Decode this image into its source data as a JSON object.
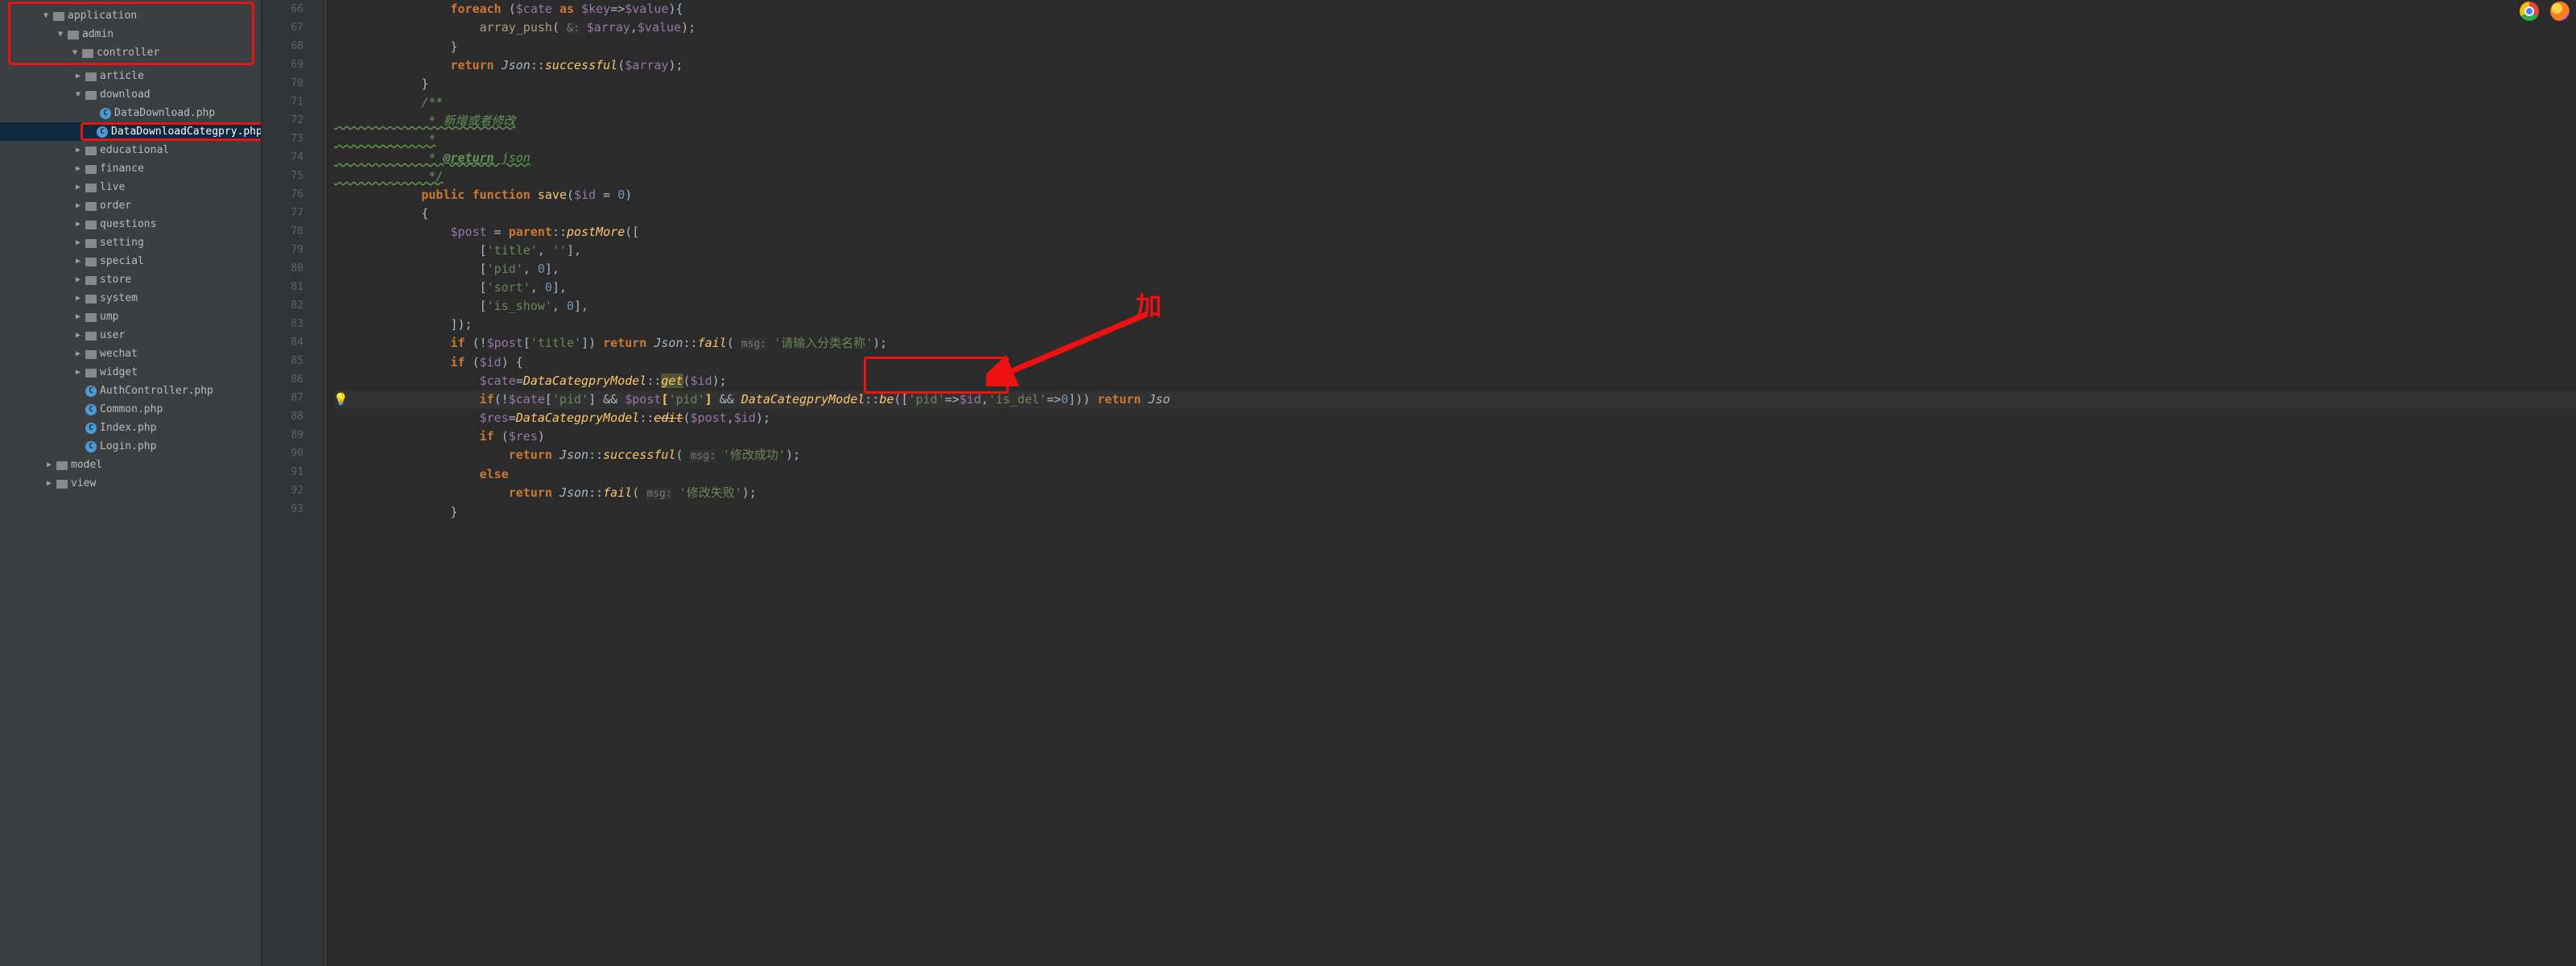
{
  "sidebar": {
    "items": [
      {
        "depth": 2,
        "arrow": "down",
        "kind": "folder",
        "label": "application"
      },
      {
        "depth": 3,
        "arrow": "down",
        "kind": "folder",
        "label": "admin"
      },
      {
        "depth": 4,
        "arrow": "down",
        "kind": "folder",
        "label": "controller"
      },
      {
        "depth": 5,
        "arrow": "right",
        "kind": "folder",
        "label": "article"
      },
      {
        "depth": 5,
        "arrow": "down",
        "kind": "folder",
        "label": "download"
      },
      {
        "depth": 6,
        "arrow": "",
        "kind": "file",
        "label": "DataDownload.php"
      },
      {
        "depth": 6,
        "arrow": "",
        "kind": "file",
        "label": "DataDownloadCategpry.php",
        "selected": true
      },
      {
        "depth": 5,
        "arrow": "right",
        "kind": "folder",
        "label": "educational"
      },
      {
        "depth": 5,
        "arrow": "right",
        "kind": "folder",
        "label": "finance"
      },
      {
        "depth": 5,
        "arrow": "right",
        "kind": "folder",
        "label": "live"
      },
      {
        "depth": 5,
        "arrow": "right",
        "kind": "folder",
        "label": "order"
      },
      {
        "depth": 5,
        "arrow": "right",
        "kind": "folder",
        "label": "questions"
      },
      {
        "depth": 5,
        "arrow": "right",
        "kind": "folder",
        "label": "setting"
      },
      {
        "depth": 5,
        "arrow": "right",
        "kind": "folder",
        "label": "special"
      },
      {
        "depth": 5,
        "arrow": "right",
        "kind": "folder",
        "label": "store"
      },
      {
        "depth": 5,
        "arrow": "right",
        "kind": "folder",
        "label": "system"
      },
      {
        "depth": 5,
        "arrow": "right",
        "kind": "folder",
        "label": "ump"
      },
      {
        "depth": 5,
        "arrow": "right",
        "kind": "folder",
        "label": "user"
      },
      {
        "depth": 5,
        "arrow": "right",
        "kind": "folder",
        "label": "wechat"
      },
      {
        "depth": 5,
        "arrow": "right",
        "kind": "folder",
        "label": "widget"
      },
      {
        "depth": 5,
        "arrow": "",
        "kind": "file",
        "label": "AuthController.php"
      },
      {
        "depth": 5,
        "arrow": "",
        "kind": "file",
        "label": "Common.php"
      },
      {
        "depth": 5,
        "arrow": "",
        "kind": "file",
        "label": "Index.php"
      },
      {
        "depth": 5,
        "arrow": "",
        "kind": "file",
        "label": "Login.php"
      },
      {
        "depth": 3,
        "arrow": "right",
        "kind": "folder",
        "label": "model"
      },
      {
        "depth": 3,
        "arrow": "right",
        "kind": "folder",
        "label": "view"
      }
    ]
  },
  "code": {
    "first_line": 66,
    "lines": [
      {
        "html": "                <span class='kw'>foreach</span> (<span class='var'>$cate</span> <span class='kw'>as</span> <span class='var'>$key</span>=&gt;<span class='var'>$value</span>){"
      },
      {
        "html": "                    <span class='call'>array_push</span>( <span class='hint'>&amp;:</span> <span class='var'>$array</span>,<span class='var'>$value</span>);"
      },
      {
        "html": "                }"
      },
      {
        "html": "                <span class='kw'>return</span> <span class='sta'>Json</span>::<span class='fn'>successful</span>(<span class='var'>$array</span>);"
      },
      {
        "html": "            }"
      },
      {
        "html": "            <span class='cmt'>/**</span>"
      },
      {
        "html": "<span class='wavy'>             <span class='cmt'>* 新增或者修改</span></span>"
      },
      {
        "html": "<span class='wavy'>             <span class='cmt'>*</span></span>"
      },
      {
        "html": "<span class='wavy'>             <span class='cmt'>* <span class='cmttag'>@return</span> json</span></span>"
      },
      {
        "html": "<span class='wavy'>             <span class='cmt'>*/</span></span>"
      },
      {
        "html": "            <span class='kw'>public function</span> <span class='fn' style='font-style:normal'>save</span>(<span class='var'>$id</span> = <span class='num'>0</span>)"
      },
      {
        "html": "            {"
      },
      {
        "html": "                <span class='var'>$post</span> = <span class='kw'>parent</span>::<span class='fn'>postMore</span>(["
      },
      {
        "html": "                    [<span class='str'>'title'</span>, <span class='str'>''</span>],"
      },
      {
        "html": "                    [<span class='str'>'pid'</span>, <span class='num'>0</span>],"
      },
      {
        "html": "                    [<span class='str'>'sort'</span>, <span class='num'>0</span>],"
      },
      {
        "html": "                    [<span class='str'>'is_show'</span>, <span class='num'>0</span>],"
      },
      {
        "html": "                ]);"
      },
      {
        "html": "                <span class='kw'>if</span> (!<span class='var'>$post</span>[<span class='str'>'title'</span>]) <span class='kw'>return</span> <span class='sta'>Json</span>::<span class='fn'>fail</span>( <span class='hint'>msg:</span> <span class='str'>'请输入分类名称'</span>);"
      },
      {
        "html": "                <span class='kw'>if</span> (<span class='var'>$id</span>) {"
      },
      {
        "html": "                    <span class='var'>$cate</span>=<span class='fn'>DataCategpryModel</span>::<span class='fn hly'>get</span>(<span class='var'>$id</span>);"
      },
      {
        "html": "                    <span class='kw'>if</span>(!<span class='var'>$cate</span>[<span class='str'>'pid'</span>] &amp;&amp; <span class='var'>$post</span><span class='hlb'>[</span><span class='str'>'pid'</span><span class='hlb'>]</span> &amp;&amp; <span class='fn'>DataCategpryModel</span>::<span class='fn'>be</span>([<span class='str'>'pid'</span>=&gt;<span class='var'>$id</span>,<span class='str'>'is_del'</span>=&gt;<span class='num'>0</span>])) <span class='kw'>return</span> <span class='sta'>Jso</span>",
        "hi": true,
        "bulb": true
      },
      {
        "html": "                    <span class='var'>$res</span>=<span class='fn'>DataCategpryModel</span>::<span class='fn'><s>edit</s></span>(<span class='var'>$post</span>,<span class='var'>$id</span>);"
      },
      {
        "html": "                    <span class='kw'>if</span> (<span class='var'>$res</span>)"
      },
      {
        "html": "                        <span class='kw'>return</span> <span class='sta'>Json</span>::<span class='fn'>successful</span>( <span class='hint'>msg:</span> <span class='str'>'修改成功'</span>);"
      },
      {
        "html": "                    <span class='kw'>else</span>"
      },
      {
        "html": "                        <span class='kw'>return</span> <span class='sta'>Json</span>::<span class='fn'>fail</span>( <span class='hint'>msg:</span> <span class='str'>'修改失败'</span>);"
      },
      {
        "html": "                }"
      }
    ]
  },
  "overlay": {
    "note": "加"
  }
}
